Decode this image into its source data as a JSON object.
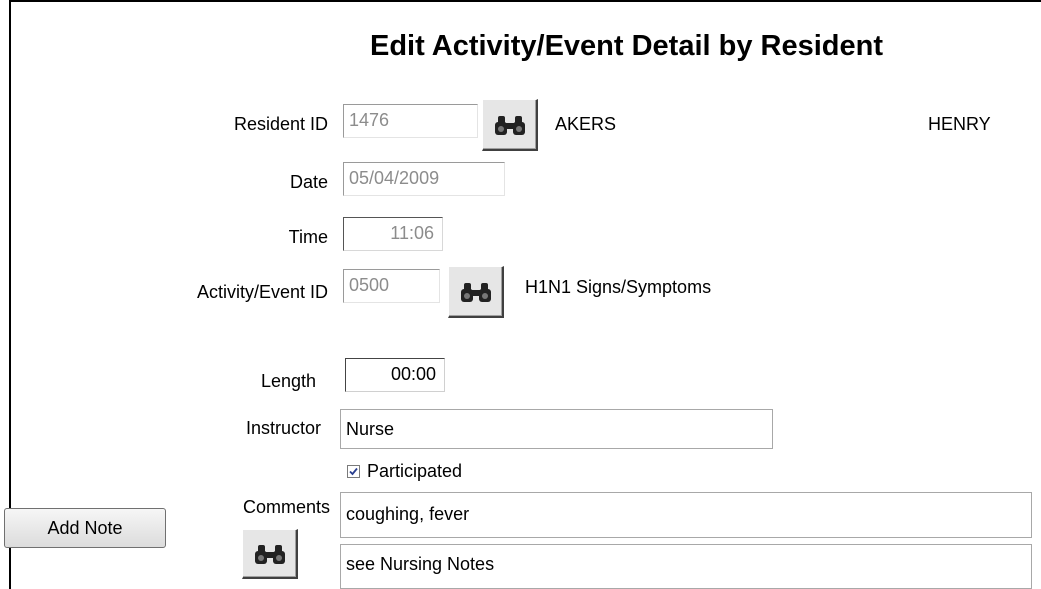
{
  "form": {
    "title": "Edit Activity/Event Detail by Resident"
  },
  "resident": {
    "label": "Resident ID",
    "id": "1476",
    "last_name": "AKERS",
    "first_name": "HENRY",
    "lookup_icon": "binoculars-icon"
  },
  "date": {
    "label": "Date",
    "value": "05/04/2009"
  },
  "time": {
    "label": "Time",
    "value": "11:06"
  },
  "activity": {
    "label": "Activity/Event ID",
    "id": "0500",
    "description": "H1N1 Signs/Symptoms",
    "lookup_icon": "binoculars-icon"
  },
  "length": {
    "label": "Length",
    "value": "00:00"
  },
  "instructor": {
    "label": "Instructor",
    "value": "Nurse"
  },
  "participated": {
    "label": "Participated",
    "checked": true
  },
  "comments": {
    "label": "Comments",
    "line1": "coughing, fever",
    "line2": "see Nursing Notes",
    "lookup_icon": "binoculars-icon"
  },
  "buttons": {
    "add_note": "Add Note"
  }
}
